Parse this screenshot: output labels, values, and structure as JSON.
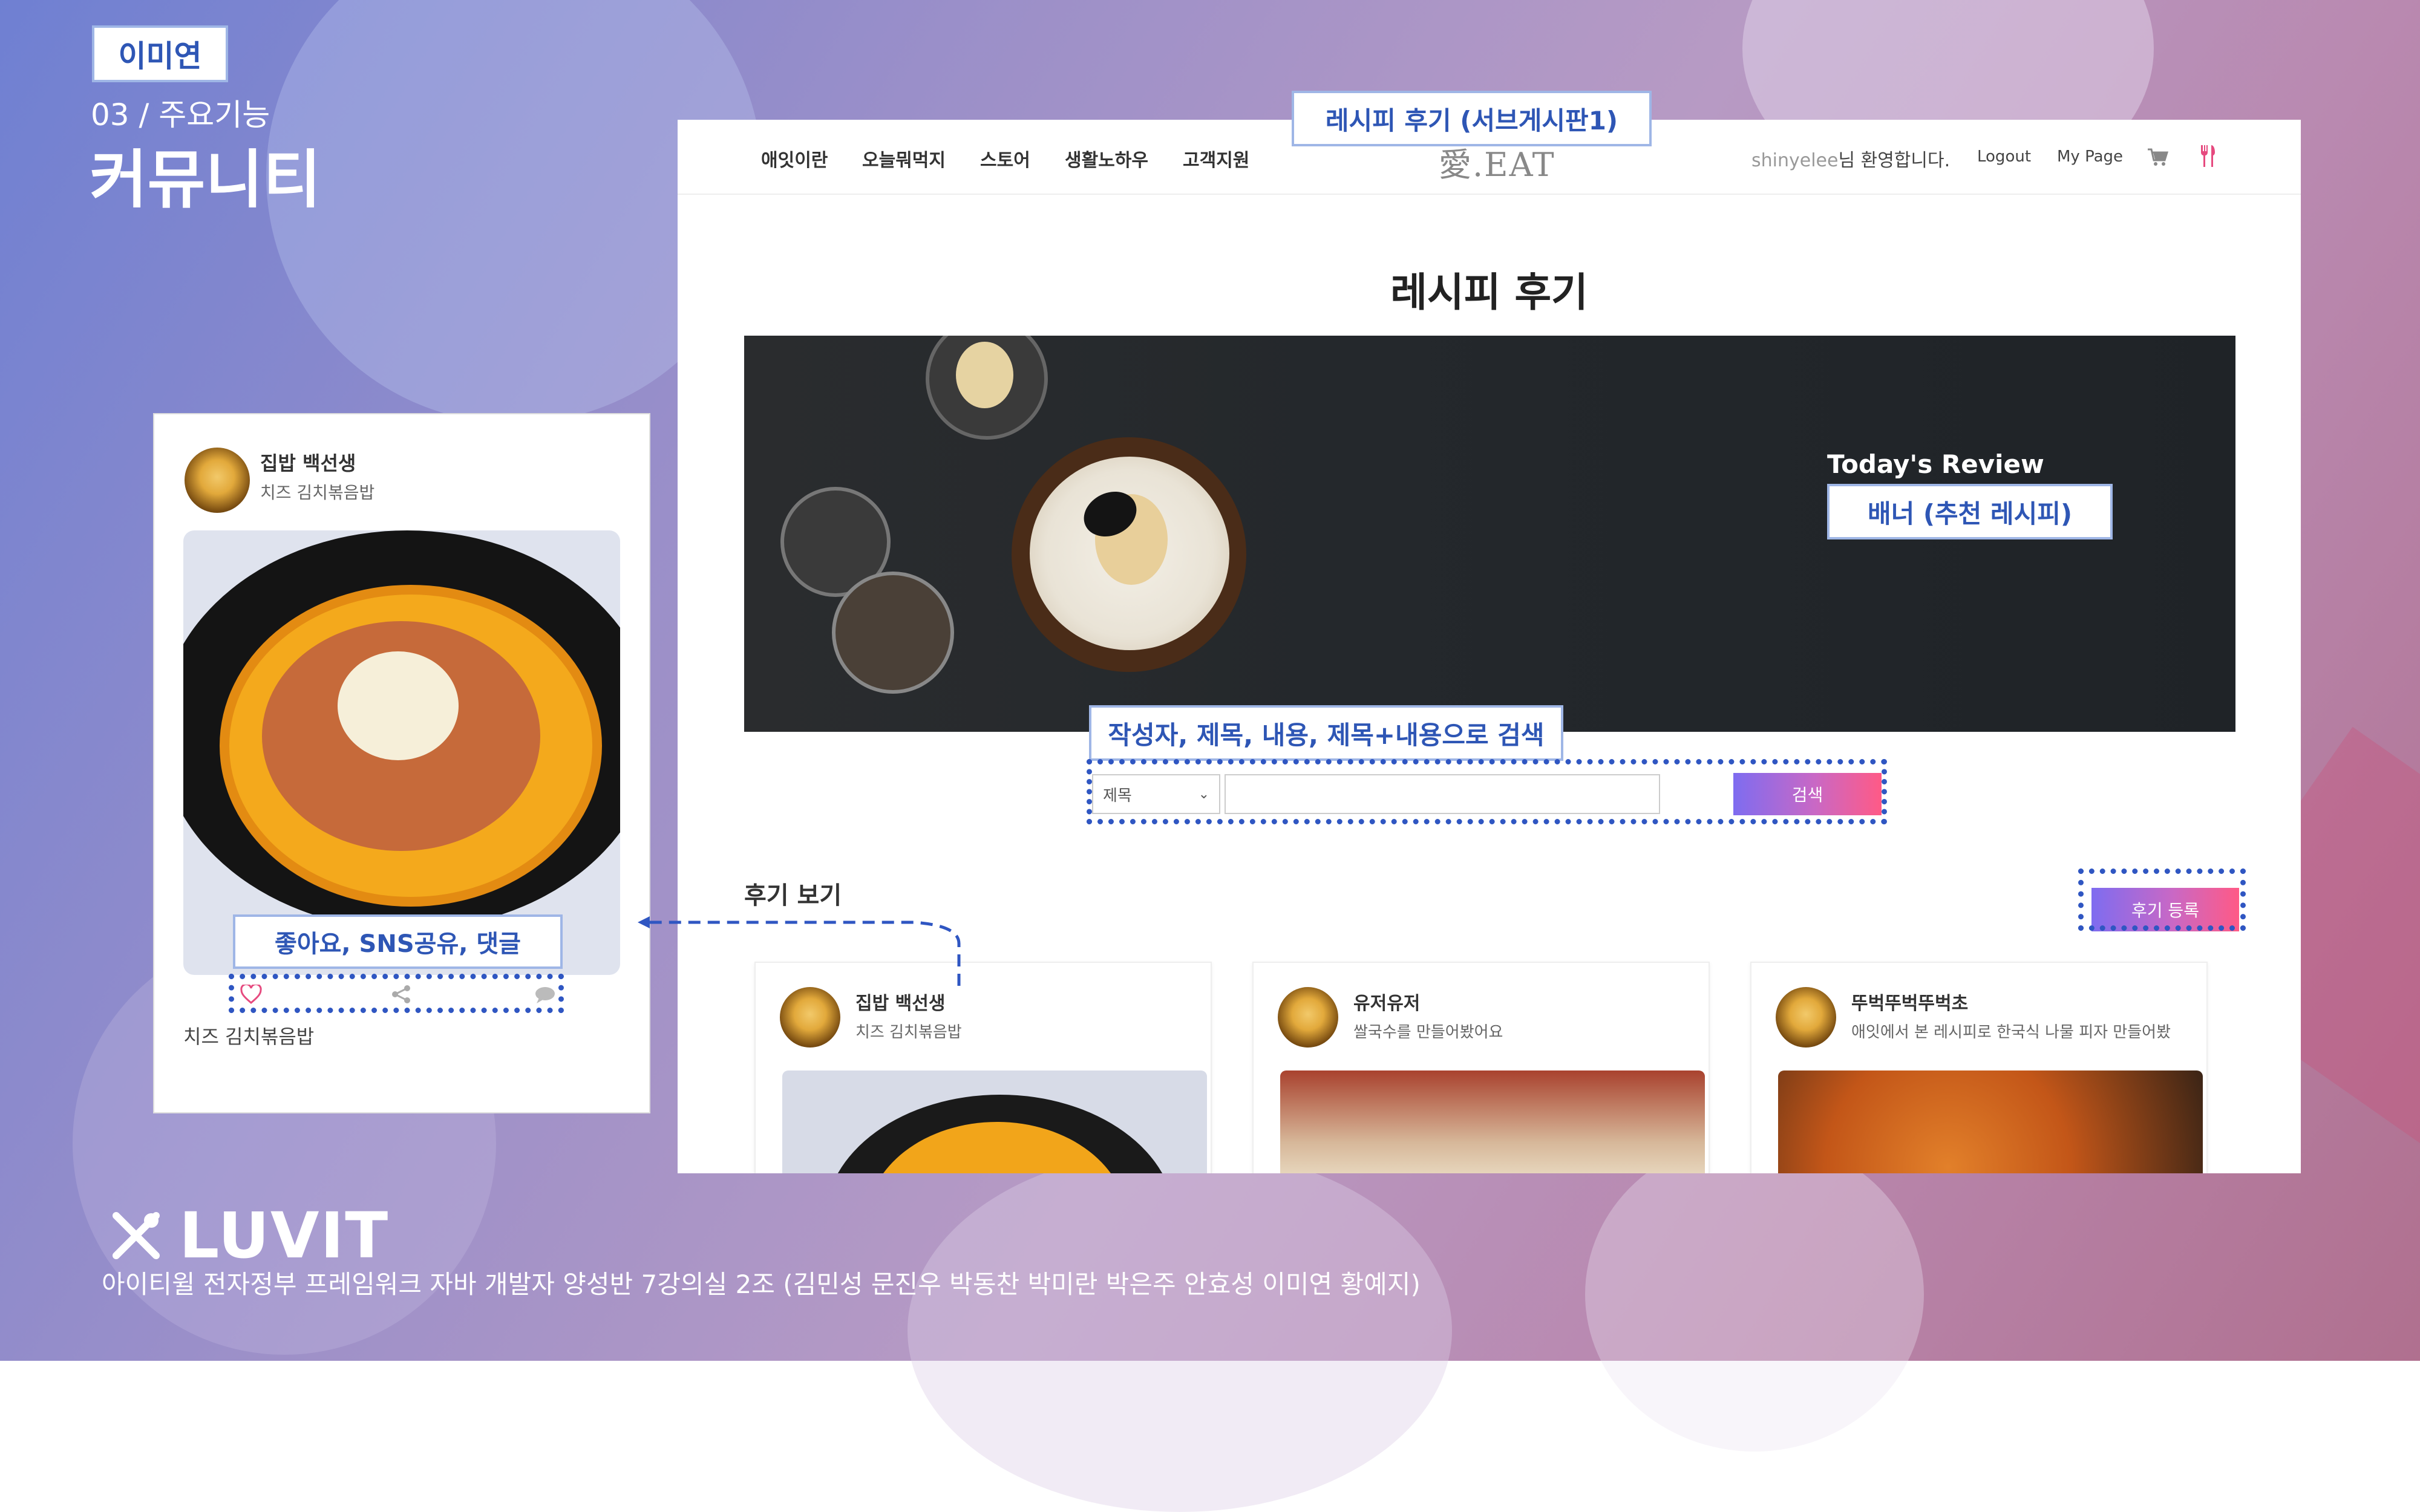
{
  "slide": {
    "author_tag": "이미연",
    "section": "03 / 주요기능",
    "heading": "커뮤니티",
    "brand": "LUVIT",
    "credits": "아이티윌 전자정부 프레임워크 자바 개발자 양성반 7강의실 2조 (김민성 문진우 박동찬 박미란 박은주 안효성 이미연 황예지)"
  },
  "callouts": {
    "page": "레시피 후기 (서브게시판1)",
    "banner": "배너 (추천 레시피)",
    "search": "작성자, 제목, 내용, 제목+내용으로 검색",
    "actions": "좋아요, SNS공유, 댓글"
  },
  "site": {
    "nav": [
      "애잇이란",
      "오늘뭐먹지",
      "스토어",
      "생활노하우",
      "고객지원"
    ],
    "logo": "愛.EAT",
    "user_id": "shinyelee",
    "welcome": "님 환영합니다.",
    "logout": "Logout",
    "mypage": "My Page",
    "cart_icon": "cart-icon",
    "utensils_icon": "utensils-icon",
    "accent": "#e64a7f"
  },
  "page": {
    "title": "레시피 후기",
    "banner_caption": "Today's Review",
    "search_select": "제목",
    "search_input_value": "",
    "search_button": "검색",
    "list_heading": "후기 보기",
    "register_button": "후기 등록"
  },
  "cards": [
    {
      "author": "집밥 백선생",
      "subtitle": "치즈 김치볶음밥"
    },
    {
      "author": "유저유저",
      "subtitle": "쌀국수를 만들어봤어요"
    },
    {
      "author": "뚜벅뚜벅뚜벅초",
      "subtitle": "애잇에서 본 레시피로 한국식 나물 피자 만들어봤"
    }
  ],
  "detail_card": {
    "author": "집밥 백선생",
    "subtitle": "치즈 김치볶음밥",
    "caption": "치즈 김치볶음밥",
    "icons": [
      "heart-icon",
      "share-icon",
      "comment-icon"
    ]
  }
}
